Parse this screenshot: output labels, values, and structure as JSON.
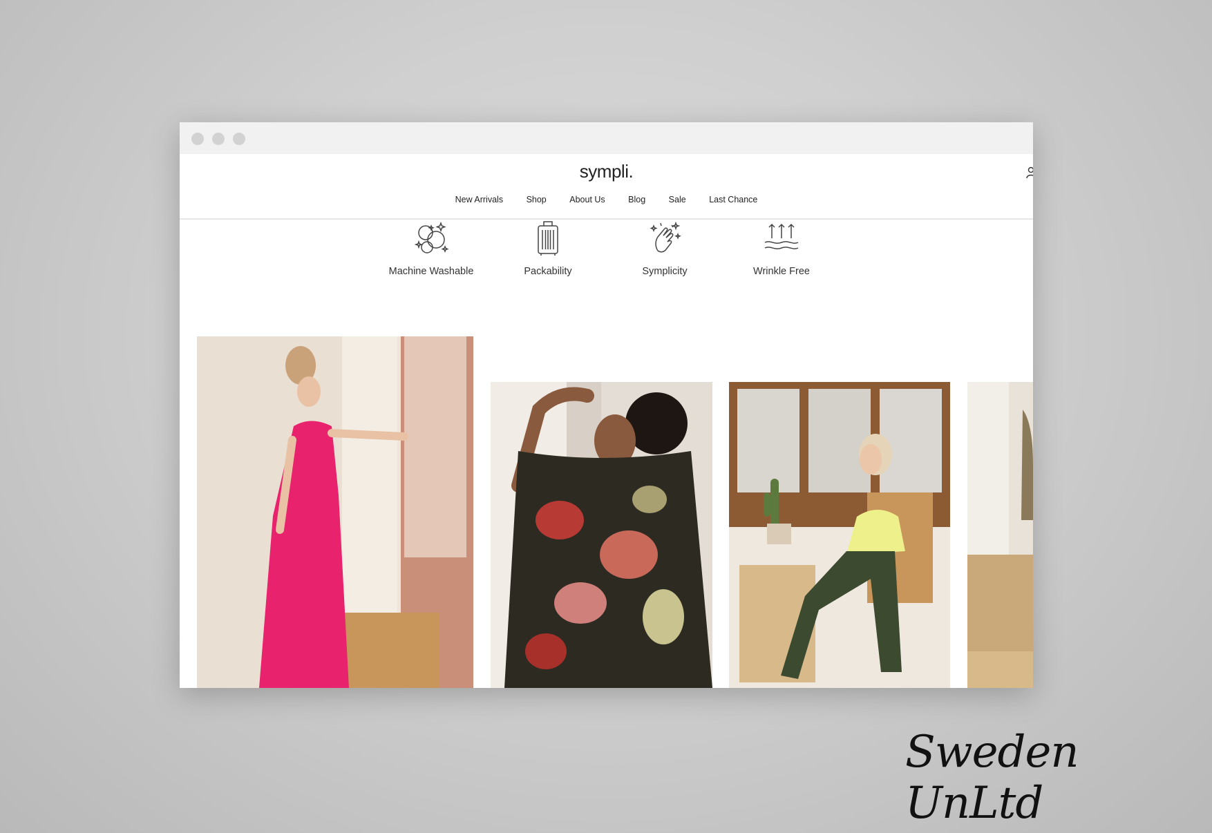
{
  "brand": {
    "logo": "sympli."
  },
  "nav": {
    "items": [
      {
        "label": "New Arrivals"
      },
      {
        "label": "Shop"
      },
      {
        "label": "About Us"
      },
      {
        "label": "Blog"
      },
      {
        "label": "Sale"
      },
      {
        "label": "Last Chance"
      }
    ]
  },
  "features": [
    {
      "label": "Machine Washable",
      "icon": "washing-bubbles-icon"
    },
    {
      "label": "Packability",
      "icon": "suitcase-icon"
    },
    {
      "label": "Symplicity",
      "icon": "snap-fingers-icon"
    },
    {
      "label": "Wrinkle Free",
      "icon": "wrinkle-free-arrows-icon"
    }
  ],
  "gallery": [
    {
      "alt": "Woman in pink sleeveless maxi dress by a window"
    },
    {
      "alt": "Woman in dark floral sheer poncho top"
    },
    {
      "alt": "Woman in yellow tank and olive pants seated in rattan chair"
    },
    {
      "alt": "Partially visible lifestyle photo with rattan chair"
    }
  ],
  "watermark": "Sweden UnLtd",
  "colors": {
    "accent_pink": "#e8226c",
    "olive": "#3c4a30",
    "page_bg": "#ffffff"
  }
}
